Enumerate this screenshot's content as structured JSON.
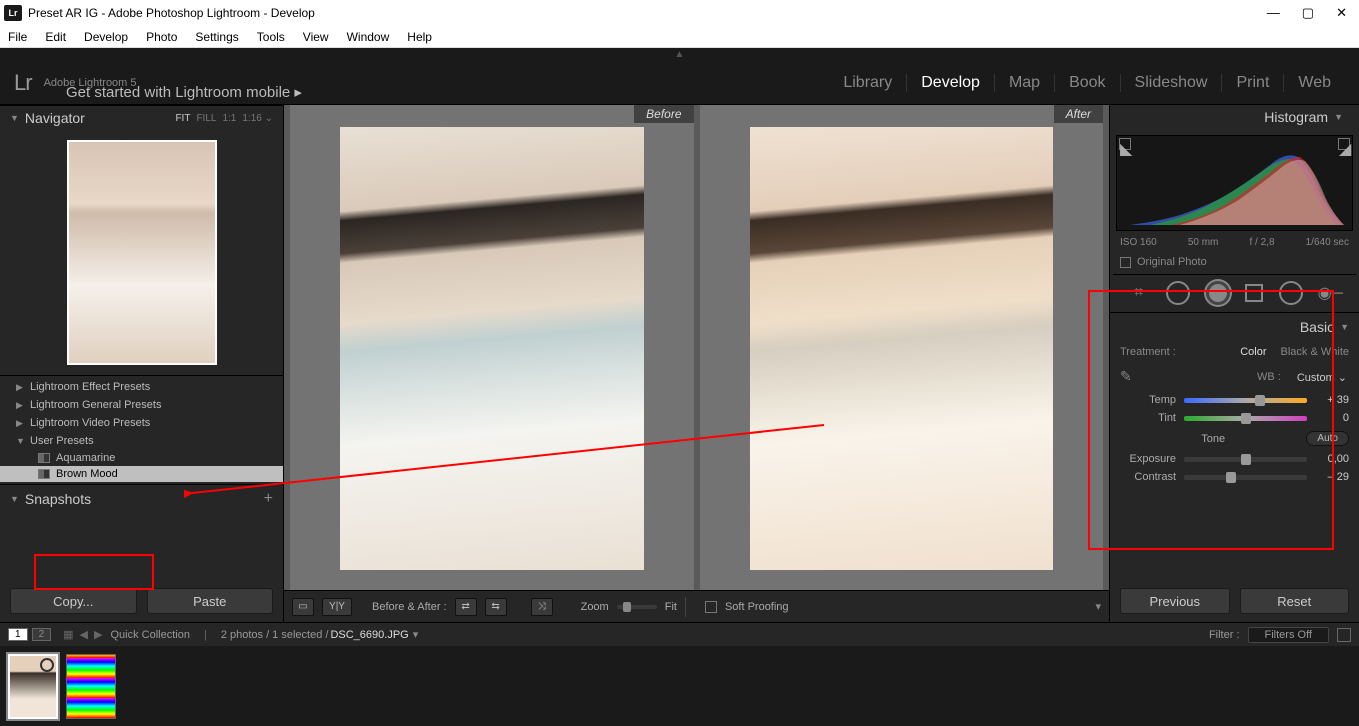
{
  "titlebar": {
    "logo": "Lr",
    "title": "Preset AR IG - Adobe Photoshop Lightroom - Develop"
  },
  "menubar": [
    "File",
    "Edit",
    "Develop",
    "Photo",
    "Settings",
    "Tools",
    "View",
    "Window",
    "Help"
  ],
  "header": {
    "lr": "Lr",
    "sub": "Adobe Lightroom 5",
    "getstarted": "Get started with Lightroom mobile  ▸",
    "modules": [
      "Library",
      "Develop",
      "Map",
      "Book",
      "Slideshow",
      "Print",
      "Web"
    ],
    "active_module": "Develop"
  },
  "navigator": {
    "title": "Navigator",
    "opts": [
      "FIT",
      "FILL",
      "1:1",
      "1:16 ⌄"
    ]
  },
  "presets": {
    "folders": [
      "Lightroom Effect Presets",
      "Lightroom General Presets",
      "Lightroom Video Presets"
    ],
    "user_folder": "User Presets",
    "user_items": [
      "Aquamarine",
      "Brown Mood"
    ],
    "selected": "Brown Mood"
  },
  "snapshots": {
    "title": "Snapshots"
  },
  "left_buttons": {
    "copy": "Copy...",
    "paste": "Paste"
  },
  "compare": {
    "before": "Before",
    "after": "After"
  },
  "toolbar2": {
    "before_after": "Before & After :",
    "zoom": "Zoom",
    "fit": "Fit",
    "soft_proofing": "Soft Proofing"
  },
  "filmstrip": {
    "pages": [
      "1",
      "2"
    ],
    "quick": "Quick Collection",
    "info": "2 photos / 1 selected /",
    "filename": "DSC_6690.JPG",
    "filter": "Filter :",
    "filter_val": "Filters Off"
  },
  "histogram": {
    "title": "Histogram",
    "iso": "ISO 160",
    "focal": "50 mm",
    "aperture": "f / 2,8",
    "shutter": "1/640 sec",
    "original": "Original Photo"
  },
  "basic": {
    "title": "Basic",
    "treatment_label": "Treatment :",
    "color": "Color",
    "bw": "Black & White",
    "wb_label": "WB :",
    "wb_value": "Custom ⌄",
    "temp_label": "Temp",
    "temp_value": "+ 39",
    "tint_label": "Tint",
    "tint_value": "0",
    "tone_label": "Tone",
    "auto": "Auto",
    "exposure_label": "Exposure",
    "exposure_value": "0,00",
    "contrast_label": "Contrast",
    "contrast_value": "– 29"
  },
  "right_buttons": {
    "previous": "Previous",
    "reset": "Reset"
  }
}
